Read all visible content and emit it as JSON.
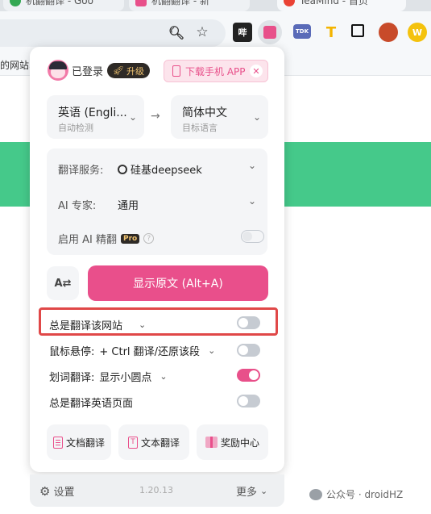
{
  "browser": {
    "tabs": [
      {
        "title": "机翻翻译 - Goo",
        "favicon_color": "#34a853"
      },
      {
        "title": "机翻翻译 - 新",
        "favicon_color": "#e8508a"
      },
      {
        "title": "TeaMind - 首页",
        "favicon_color": "#ea4335"
      }
    ],
    "bookmarks_text": "的网站收",
    "extension_icons": [
      "哔",
      "TDK",
      "T",
      "W"
    ]
  },
  "popup": {
    "user": {
      "status": "已登录",
      "upgrade": "升级"
    },
    "download_app": "下载手机 APP",
    "source_lang": {
      "name": "英语 (Engli...",
      "sub": "自动检测"
    },
    "target_lang": {
      "name": "简体中文",
      "sub": "目标语言"
    },
    "service": {
      "label": "翻译服务:",
      "value": "硅基deepseek"
    },
    "expert": {
      "label": "AI 专家:",
      "value": "通用"
    },
    "ai_refine": {
      "label": "启用 AI 精翻",
      "badge": "Pro"
    },
    "show_original": "显示原文 (Alt+A)",
    "options": {
      "always_site": {
        "label": "总是翻译该网站",
        "on": false
      },
      "hover": {
        "label": "鼠标悬停:",
        "value": "+ Ctrl 翻译/还原该段",
        "on": false
      },
      "selection": {
        "label": "划词翻译:",
        "value": "显示小圆点",
        "on": true
      },
      "always_english": {
        "label": "总是翻译英语页面",
        "on": false
      }
    },
    "actions": {
      "doc": "文档翻译",
      "text": "文本翻译",
      "rewards": "奖励中心"
    },
    "footer": {
      "settings": "设置",
      "version": "1.20.13",
      "more": "更多"
    }
  },
  "watermark": "公众号 · droidHZ",
  "colors": {
    "accent": "#e94f8b",
    "band": "#45c98a",
    "highlight": "#e04848"
  }
}
